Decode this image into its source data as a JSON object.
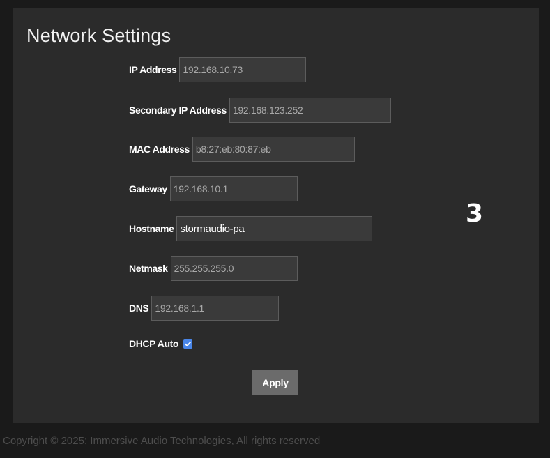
{
  "title": "Network Settings",
  "fields": [
    {
      "label": "IP Address",
      "value": "192.168.10.73"
    },
    {
      "label": "Secondary IP Address",
      "value": "192.168.123.252"
    },
    {
      "label": "MAC Address",
      "value": "b8:27:eb:80:87:eb"
    },
    {
      "label": "Gateway",
      "value": "192.168.10.1"
    },
    {
      "label": "Hostname",
      "value": "stormaudio-pa"
    },
    {
      "label": "Netmask",
      "value": "255.255.255.0"
    },
    {
      "label": "DNS",
      "value": "192.168.1.1"
    }
  ],
  "dhcp": {
    "label": "DHCP Auto",
    "checked": true
  },
  "apply_label": "Apply",
  "badge": "3",
  "footer": "Copyright © 2025; Immersive Audio Technologies, All rights reserved",
  "colors": {
    "background": "#1a1a1a",
    "panel": "#2b2b2b",
    "input_bg": "#3a3a3a",
    "button": "#6b6b6b",
    "checkbox": "#4a86e8"
  }
}
